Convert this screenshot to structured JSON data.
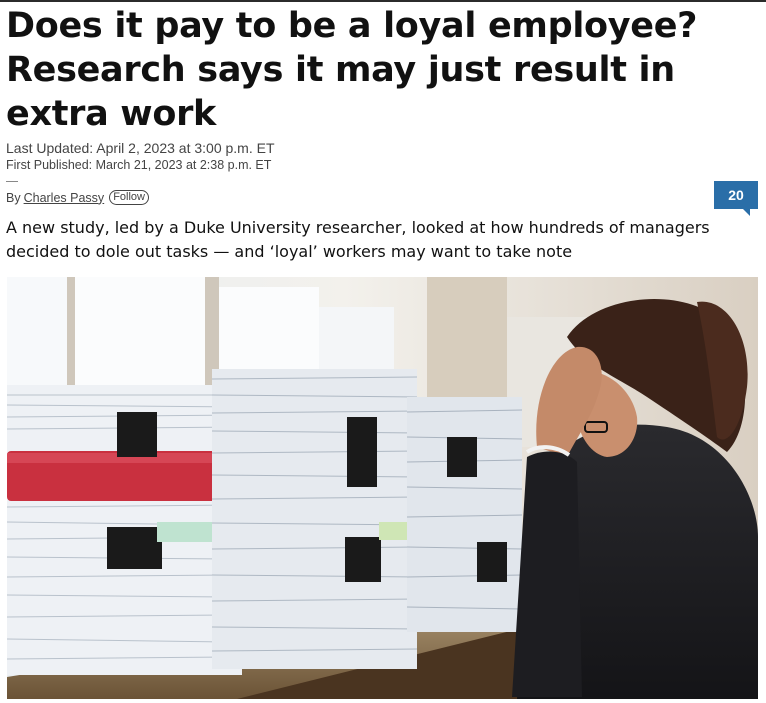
{
  "article": {
    "headline": "Does it pay to be a loyal employee? Research says it may just result in extra work",
    "last_updated": "Last Updated: April 2, 2023 at 3:00 p.m. ET",
    "first_published": "First Published: March 21, 2023 at 2:38 p.m. ET",
    "byline_prefix": "By",
    "author": "Charles Passy",
    "follow_label": "Follow",
    "comment_count": "20",
    "dek": "A new study, led by a Duke University researcher, looked at how hundreds of managers decided to dole out tasks — and ‘loyal’ workers may want to take note"
  },
  "icons": {
    "comment": "comment-bubble-icon"
  },
  "colors": {
    "badge": "#2a6ea8",
    "text": "#111111"
  }
}
